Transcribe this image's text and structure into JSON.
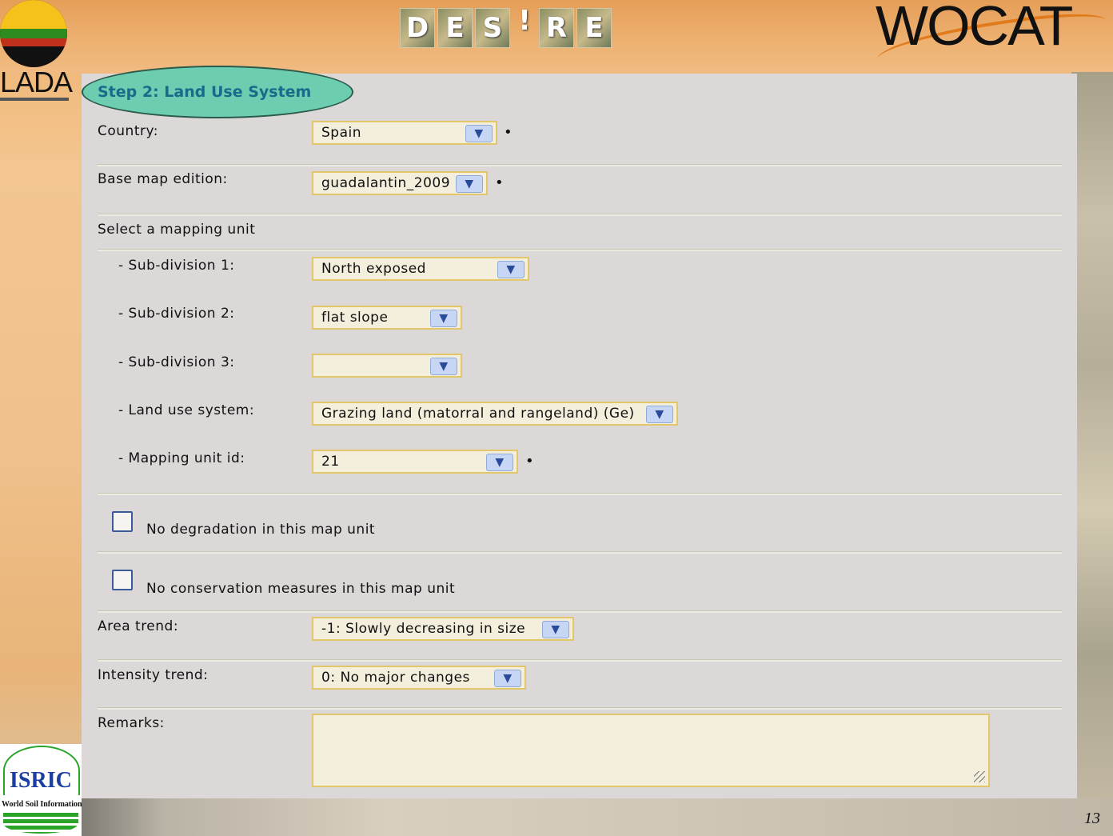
{
  "header": {
    "lada_logo_text": "LADA",
    "desire_letters": [
      "D",
      "E",
      "S",
      "!",
      "R",
      "E"
    ],
    "wocat_logo_text": "WOCAT",
    "isric_logo_text": "ISRIC",
    "isric_subtitle": "World Soil Information"
  },
  "form": {
    "step_title": "Step 2: Land Use System",
    "country": {
      "label": "Country:",
      "value": "Spain",
      "required": "•"
    },
    "base_map": {
      "label": "Base map edition:",
      "value": "guadalantin_2009",
      "required": "•"
    },
    "mapping_unit_heading": "Select a mapping unit",
    "subdivision1": {
      "label": "- Sub-division 1:",
      "value": "North exposed"
    },
    "subdivision2": {
      "label": "- Sub-division 2:",
      "value": "flat slope"
    },
    "subdivision3": {
      "label": "- Sub-division 3:",
      "value": ""
    },
    "land_use_system": {
      "label": "- Land use system:",
      "value": "Grazing land (matorral and rangeland) (Ge)"
    },
    "mapping_unit_id": {
      "label": "- Mapping unit id:",
      "value": "21",
      "required": "•"
    },
    "no_degradation": {
      "label": "No degradation in this map unit"
    },
    "no_conservation": {
      "label": "No conservation measures in this map unit"
    },
    "area_trend": {
      "label": "Area trend:",
      "value": "-1: Slowly decreasing in size"
    },
    "intensity_trend": {
      "label": "Intensity trend:",
      "value": "0: No major changes"
    },
    "remarks": {
      "label": "Remarks:",
      "value": ""
    }
  },
  "icons": {
    "dropdown": "chevron-down-icon",
    "resize": "resize-grip-icon"
  },
  "footer": {
    "page_number": "13"
  },
  "colors": {
    "panel": "#dcd8d8",
    "select_bg": "#f3efdc",
    "select_border": "#e2c66a",
    "title_bg": "#6dcdb1",
    "title_text": "#1a6a8a"
  }
}
